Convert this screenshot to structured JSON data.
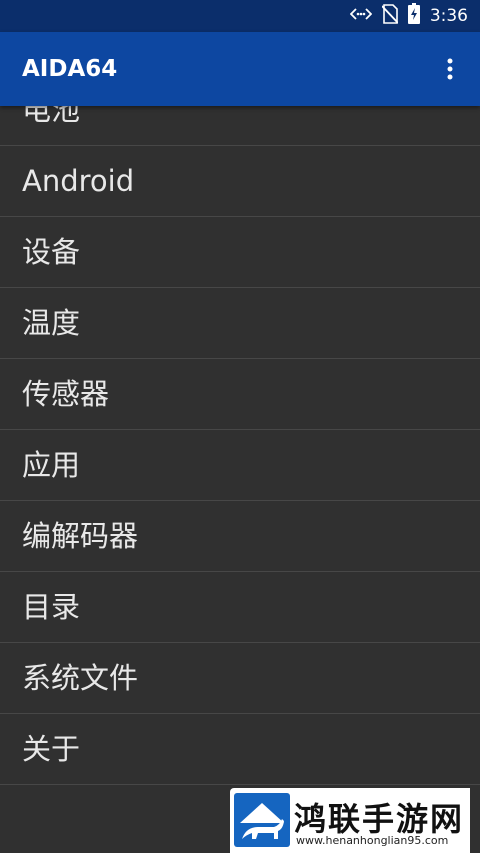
{
  "status_bar": {
    "time": "3:36",
    "icons": [
      "data-transfer-icon",
      "no-sim-icon",
      "battery-charging-icon"
    ]
  },
  "app_bar": {
    "title": "AIDA64",
    "menu_icon": "overflow-menu-icon"
  },
  "menu_items": [
    {
      "label": "电池"
    },
    {
      "label": "Android"
    },
    {
      "label": "设备"
    },
    {
      "label": "温度"
    },
    {
      "label": "传感器"
    },
    {
      "label": "应用"
    },
    {
      "label": "编解码器"
    },
    {
      "label": "目录"
    },
    {
      "label": "系统文件"
    },
    {
      "label": "关于"
    }
  ],
  "watermark": {
    "brand": "鸿联手游网",
    "url": "www.henanhonglian95.com",
    "icon": "bull-logo-icon"
  },
  "colors": {
    "status_bar": "#0b2e6b",
    "app_bar": "#0d47a1",
    "background": "#303030",
    "divider": "#474747",
    "text": "#e8e8e8"
  }
}
